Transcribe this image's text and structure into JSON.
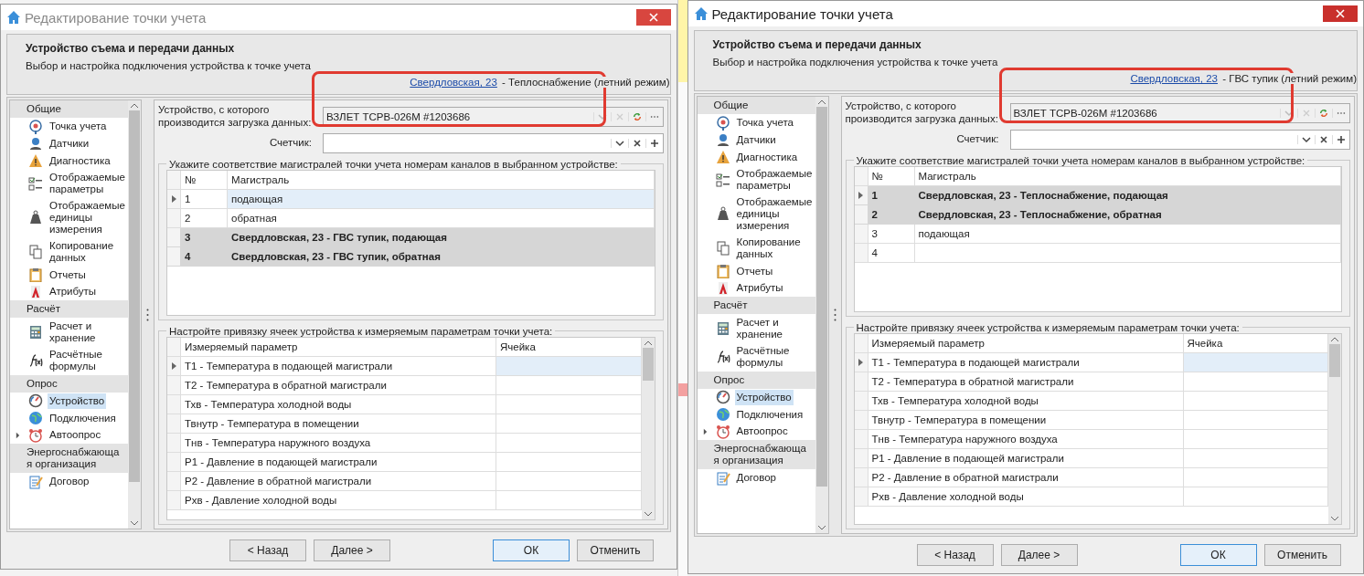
{
  "windows": [
    {
      "title": "Редактирование точки учета",
      "active": false,
      "highlight": true,
      "header": {
        "title": "Устройство съема и передачи данных",
        "subtitle": "Выбор и настройка подключения устройства к точке учета"
      },
      "location": {
        "link": "Свердловская, 23",
        "text": " - Теплоснабжение (летний режим)"
      },
      "sidebar": [
        {
          "kind": "group",
          "label": "Общие"
        },
        {
          "kind": "item",
          "label": "Точка учета",
          "selected": false
        },
        {
          "kind": "item",
          "label": "Датчики",
          "selected": false
        },
        {
          "kind": "item",
          "label": "Диагностика",
          "selected": false
        },
        {
          "kind": "item",
          "label": "Отображаемые параметры",
          "selected": false
        },
        {
          "kind": "item",
          "label": "Отображаемые единицы измерения",
          "selected": false
        },
        {
          "kind": "item",
          "label": "Копирование данных",
          "selected": false
        },
        {
          "kind": "item",
          "label": "Отчеты",
          "selected": false
        },
        {
          "kind": "item",
          "label": "Атрибуты",
          "selected": false
        },
        {
          "kind": "group",
          "label": "Расчёт"
        },
        {
          "kind": "item",
          "label": "Расчет и хранение",
          "selected": false
        },
        {
          "kind": "item",
          "label": "Расчётные формулы",
          "selected": false
        },
        {
          "kind": "group",
          "label": "Опрос"
        },
        {
          "kind": "item",
          "label": "Устройство",
          "selected": true
        },
        {
          "kind": "item",
          "label": "Подключения",
          "selected": false
        },
        {
          "kind": "item",
          "label": "Автоопрос",
          "selected": false,
          "expandable": true
        },
        {
          "kind": "group",
          "label": "Энергоснабжающая организация"
        },
        {
          "kind": "item",
          "label": "Договор",
          "selected": false
        }
      ],
      "device": {
        "label": "Устройство, с которого производится загрузка данных:",
        "value": "ВЗЛЕТ ТСРВ-026М #1203686"
      },
      "counter": {
        "label": "Счетчик:"
      },
      "channels": {
        "legend": "Укажите соответствие магистралей точки учета номерам каналов в выбранном устройстве:",
        "columns": [
          "№",
          "Магистраль"
        ],
        "rows": [
          {
            "number": "1",
            "name": "подающая",
            "selected": true,
            "occupied": false
          },
          {
            "number": "2",
            "name": "обратная",
            "selected": false,
            "occupied": false
          },
          {
            "number": "3",
            "name": "Свердловская, 23 - ГВС тупик, подающая",
            "selected": false,
            "occupied": true
          },
          {
            "number": "4",
            "name": "Свердловская, 23 - ГВС тупик, обратная",
            "selected": false,
            "occupied": true
          }
        ]
      },
      "params": {
        "legend": "Настройте привязку ячеек устройства к измеряемым параметрам точки учета:",
        "columns": [
          "Измеряемый параметр",
          "Ячейка"
        ],
        "rows": [
          {
            "name": "Т1 - Температура в подающей магистрали",
            "selected": true
          },
          {
            "name": "Т2 - Температура в обратной магистрали",
            "selected": false
          },
          {
            "name": "Тхв - Температура холодной воды",
            "selected": false
          },
          {
            "name": "Твнутр - Температура в помещении",
            "selected": false
          },
          {
            "name": "Тнв - Температура наружного воздуха",
            "selected": false
          },
          {
            "name": "Р1 - Давление в подающей магистрали",
            "selected": false
          },
          {
            "name": "Р2 - Давление в обратной магистрали",
            "selected": false
          },
          {
            "name": "Рхв - Давление холодной воды",
            "selected": false
          }
        ]
      },
      "buttons": [
        {
          "label": "< Назад",
          "kind": "nav"
        },
        {
          "label": "Далее >",
          "kind": "nav"
        },
        {
          "label": "ОК",
          "kind": "default"
        },
        {
          "label": "Отменить",
          "kind": "cancel"
        }
      ]
    },
    {
      "title": "Редактирование точки учета",
      "active": true,
      "highlight": true,
      "header": {
        "title": "Устройство съема и передачи данных",
        "subtitle": "Выбор и настройка подключения устройства к точке учета"
      },
      "location": {
        "link": "Свердловская, 23",
        "text": " - ГВС тупик (летний режим)"
      },
      "sidebar": [
        {
          "kind": "group",
          "label": "Общие"
        },
        {
          "kind": "item",
          "label": "Точка учета",
          "selected": false
        },
        {
          "kind": "item",
          "label": "Датчики",
          "selected": false
        },
        {
          "kind": "item",
          "label": "Диагностика",
          "selected": false
        },
        {
          "kind": "item",
          "label": "Отображаемые параметры",
          "selected": false
        },
        {
          "kind": "item",
          "label": "Отображаемые единицы измерения",
          "selected": false
        },
        {
          "kind": "item",
          "label": "Копирование данных",
          "selected": false
        },
        {
          "kind": "item",
          "label": "Отчеты",
          "selected": false
        },
        {
          "kind": "item",
          "label": "Атрибуты",
          "selected": false
        },
        {
          "kind": "group",
          "label": "Расчёт"
        },
        {
          "kind": "item",
          "label": "Расчет и хранение",
          "selected": false
        },
        {
          "kind": "item",
          "label": "Расчётные формулы",
          "selected": false
        },
        {
          "kind": "group",
          "label": "Опрос"
        },
        {
          "kind": "item",
          "label": "Устройство",
          "selected": true
        },
        {
          "kind": "item",
          "label": "Подключения",
          "selected": false
        },
        {
          "kind": "item",
          "label": "Автоопрос",
          "selected": false,
          "expandable": true
        },
        {
          "kind": "group",
          "label": "Энергоснабжающая организация"
        },
        {
          "kind": "item",
          "label": "Договор",
          "selected": false
        }
      ],
      "device": {
        "label": "Устройство, с которого производится загрузка данных:",
        "value": "ВЗЛЕТ ТСРВ-026М #1203686"
      },
      "counter": {
        "label": "Счетчик:"
      },
      "channels": {
        "legend": "Укажите соответствие магистралей точки учета номерам каналов в выбранном устройстве:",
        "columns": [
          "№",
          "Магистраль"
        ],
        "rows": [
          {
            "number": "1",
            "name": "Свердловская, 23 - Теплоснабжение, подающая",
            "selected": true,
            "occupied": true
          },
          {
            "number": "2",
            "name": "Свердловская, 23 - Теплоснабжение, обратная",
            "selected": false,
            "occupied": true
          },
          {
            "number": "3",
            "name": "подающая",
            "selected": false,
            "occupied": false
          },
          {
            "number": "4",
            "selected": false,
            "occupied": false
          }
        ]
      },
      "params": {
        "legend": "Настройте привязку ячеек устройства к измеряемым параметрам точки учета:",
        "columns": [
          "Измеряемый параметр",
          "Ячейка"
        ],
        "rows": [
          {
            "name": "Т1 - Температура в подающей магистрали",
            "selected": true
          },
          {
            "name": "Т2 - Температура в обратной магистрали",
            "selected": false
          },
          {
            "name": "Тхв - Температура холодной воды",
            "selected": false
          },
          {
            "name": "Твнутр - Температура в помещении",
            "selected": false
          },
          {
            "name": "Тнв - Температура наружного воздуха",
            "selected": false
          },
          {
            "name": "Р1 - Давление в подающей магистрали",
            "selected": false
          },
          {
            "name": "Р2 - Давление в обратной магистрали",
            "selected": false
          },
          {
            "name": "Рхв - Давление холодной воды",
            "selected": false
          }
        ]
      },
      "buttons": [
        {
          "label": "< Назад",
          "kind": "nav"
        },
        {
          "label": "Далее >",
          "kind": "nav"
        },
        {
          "label": "ОК",
          "kind": "default"
        },
        {
          "label": "Отменить",
          "kind": "cancel"
        }
      ]
    }
  ]
}
